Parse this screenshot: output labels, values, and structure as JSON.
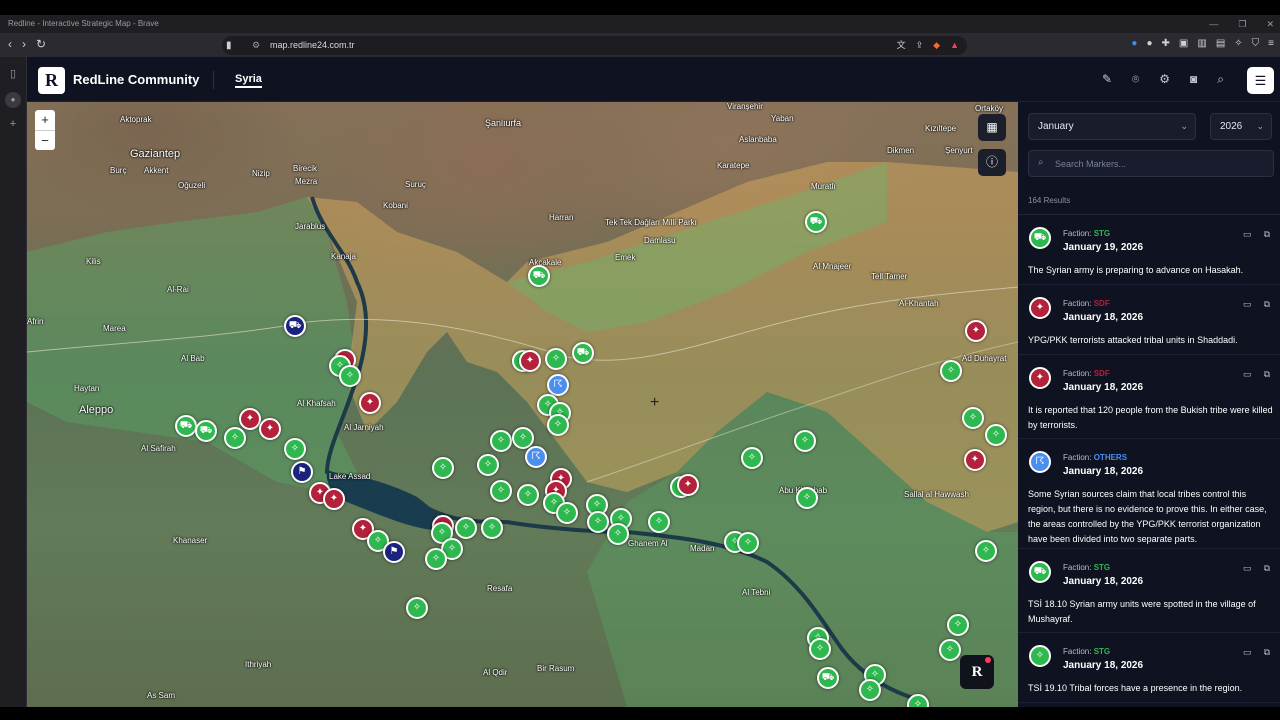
{
  "browser": {
    "window_title": "Redline - Interactive Strategic Map - Brave",
    "url": "map.redline24.com.tr"
  },
  "app": {
    "logo_letter": "R",
    "brand": "RedLine Community",
    "active_tab": "Syria"
  },
  "map": {
    "zoom_in": "+",
    "zoom_out": "−",
    "floating_logo": "R",
    "places": [
      {
        "name": "Gaziantep",
        "size": "big"
      },
      {
        "name": "Şanlıurfa",
        "size": "mid"
      },
      {
        "name": "Aleppo",
        "size": "big"
      },
      {
        "name": "Aktoprak",
        "size": "small"
      },
      {
        "name": "Kobani",
        "size": "small"
      },
      {
        "name": "Suruç",
        "size": "small"
      },
      {
        "name": "Harran",
        "size": "small"
      },
      {
        "name": "Tek Tek Dağları Milli Parkı",
        "size": "small"
      },
      {
        "name": "Akçakale",
        "size": "small"
      },
      {
        "name": "Viranşehir",
        "size": "small"
      },
      {
        "name": "Yaban",
        "size": "small"
      },
      {
        "name": "Aslanbaba",
        "size": "small"
      },
      {
        "name": "Karatepe",
        "size": "small"
      },
      {
        "name": "Muratlı",
        "size": "small"
      },
      {
        "name": "Ortaköy",
        "size": "small"
      },
      {
        "name": "Kızıltepe",
        "size": "small"
      },
      {
        "name": "Dikmen",
        "size": "small"
      },
      {
        "name": "Şenyurt",
        "size": "small"
      },
      {
        "name": "Al Mnajeer",
        "size": "small"
      },
      {
        "name": "Tell Tamer",
        "size": "small"
      },
      {
        "name": "Al-Khantah",
        "size": "small"
      },
      {
        "name": "Ad Duhayrat",
        "size": "small"
      },
      {
        "name": "Sallal al Hawwash",
        "size": "small"
      },
      {
        "name": "Abu Khashab",
        "size": "small"
      },
      {
        "name": "Al Tebni",
        "size": "small"
      },
      {
        "name": "Madan",
        "size": "small"
      },
      {
        "name": "Ghanem Al",
        "size": "small"
      },
      {
        "name": "Resafa",
        "size": "small"
      },
      {
        "name": "Bir Rasum",
        "size": "small"
      },
      {
        "name": "Al Qdir",
        "size": "small"
      },
      {
        "name": "Ithriyah",
        "size": "small"
      },
      {
        "name": "As Sam",
        "size": "small"
      },
      {
        "name": "Khanaser",
        "size": "small"
      },
      {
        "name": "Al Safirah",
        "size": "small"
      },
      {
        "name": "Al Bab",
        "size": "small"
      },
      {
        "name": "Marea",
        "size": "small"
      },
      {
        "name": "Afrin",
        "size": "small"
      },
      {
        "name": "Haytan",
        "size": "small"
      },
      {
        "name": "Al-Rai",
        "size": "small"
      },
      {
        "name": "Jarablus",
        "size": "small"
      },
      {
        "name": "Birecik",
        "size": "small"
      },
      {
        "name": "Nizip",
        "size": "small"
      },
      {
        "name": "Burç",
        "size": "small"
      },
      {
        "name": "Akkent",
        "size": "small"
      },
      {
        "name": "Oğuzeli",
        "size": "small"
      },
      {
        "name": "Kilis",
        "size": "small"
      },
      {
        "name": "Al Khafsah",
        "size": "small"
      },
      {
        "name": "Al Jarniyah",
        "size": "small"
      },
      {
        "name": "Lake Assad",
        "size": "small"
      },
      {
        "name": "Kanaja",
        "size": "small"
      },
      {
        "name": "Mezra",
        "size": "small"
      },
      {
        "name": "Damlasu",
        "size": "small"
      },
      {
        "name": "Emek",
        "size": "small"
      }
    ]
  },
  "panel": {
    "month": "January",
    "year": "2026",
    "search_placeholder": "Search Markers...",
    "results": "164 Results",
    "faction_label": "Faction:",
    "colors": {
      "STG": "#2eb84f",
      "SDF": "#b3213a",
      "OTHERS": "#4a8ff0"
    },
    "entries": [
      {
        "faction": "STG",
        "date": "January 19, 2026",
        "text": "The Syrian army is preparing to advance on Hasakah.",
        "icon": "truck-icon"
      },
      {
        "faction": "SDF",
        "date": "January 18, 2026",
        "text": "YPG/PKK terrorists attacked tribal units in Shaddadi.",
        "icon": "rifle-icon"
      },
      {
        "faction": "SDF",
        "date": "January 18, 2026",
        "text": "It is reported that 120 people from the Bukish tribe were killed by terrorists.",
        "icon": "rifle-icon"
      },
      {
        "faction": "OTHERS",
        "date": "January 18, 2026",
        "text": "Some Syrian sources claim that local tribes control this region, but there is no evidence to prove this. In either case, the areas controlled by the YPG/PKK terrorist organization have been divided into two separate parts.",
        "icon": "megaphone-icon"
      },
      {
        "faction": "STG",
        "date": "January 18, 2026",
        "text": "TSİ 18.10 Syrian army units were spotted in the village of Mushayraf.",
        "icon": "truck-icon"
      },
      {
        "faction": "STG",
        "date": "January 18, 2026",
        "text": "TSİ 19.10 Tribal forces have a presence in the region.",
        "icon": "rifle-icon"
      }
    ]
  }
}
